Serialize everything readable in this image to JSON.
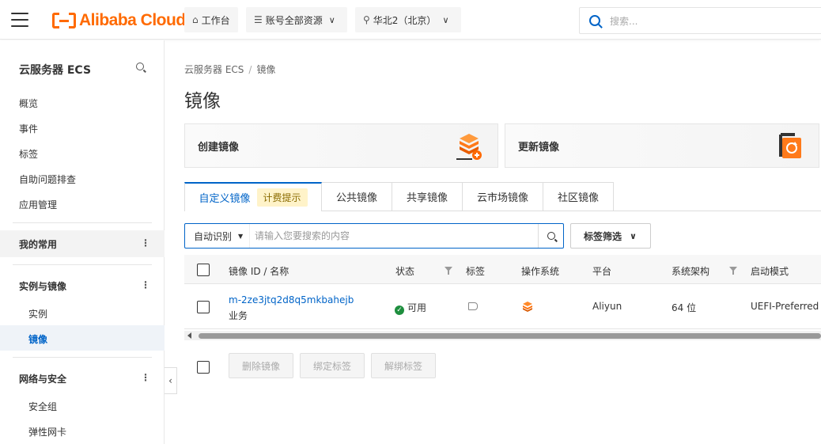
{
  "topbar": {
    "brand": "Alibaba Cloud",
    "workbench": "工作台",
    "resources": "账号全部资源",
    "region": "华北2（北京）",
    "search_placeholder": "搜索..."
  },
  "sidebar": {
    "title": "云服务器 ECS",
    "items": [
      "概览",
      "事件",
      "标签",
      "自助问题排查",
      "应用管理"
    ],
    "favorites": "我的常用",
    "group_instances": "实例与镜像",
    "instances_items": [
      "实例",
      "镜像"
    ],
    "group_network": "网络与安全",
    "network_items": [
      "安全组",
      "弹性网卡"
    ],
    "dots": "⋮",
    "collapse": "‹"
  },
  "breadcrumb": [
    "云服务器 ECS",
    "镜像"
  ],
  "breadcrumb_sep": "/",
  "page_title": "镜像",
  "cards": {
    "create": "创建镜像",
    "update": "更新镜像"
  },
  "tabs": {
    "custom": "自定义镜像",
    "billing_badge": "计费提示",
    "public": "公共镜像",
    "shared": "共享镜像",
    "marketplace": "云市场镜像",
    "community": "社区镜像"
  },
  "search": {
    "mode": "自动识别",
    "placeholder": "请输入您要搜索的内容",
    "tag_filter": "标签筛选"
  },
  "table": {
    "headers": {
      "id_name": "镜像 ID / 名称",
      "status": "状态",
      "tags": "标签",
      "os": "操作系统",
      "platform": "平台",
      "arch": "系统架构",
      "boot_mode": "启动模式"
    },
    "rows": [
      {
        "id": "m-2ze3jtq2d8q5mkbahejb",
        "name": "业务",
        "status": "可用",
        "platform": "Aliyun",
        "arch": "64 位",
        "boot_mode": "UEFI-Preferred"
      }
    ]
  },
  "actions": {
    "delete": "删除镜像",
    "bind_tag": "绑定标签",
    "unbind_tag": "解绑标签"
  },
  "colors": {
    "brand": "#ff6a00",
    "primary": "#0064c8",
    "success": "#1e8e3e"
  }
}
